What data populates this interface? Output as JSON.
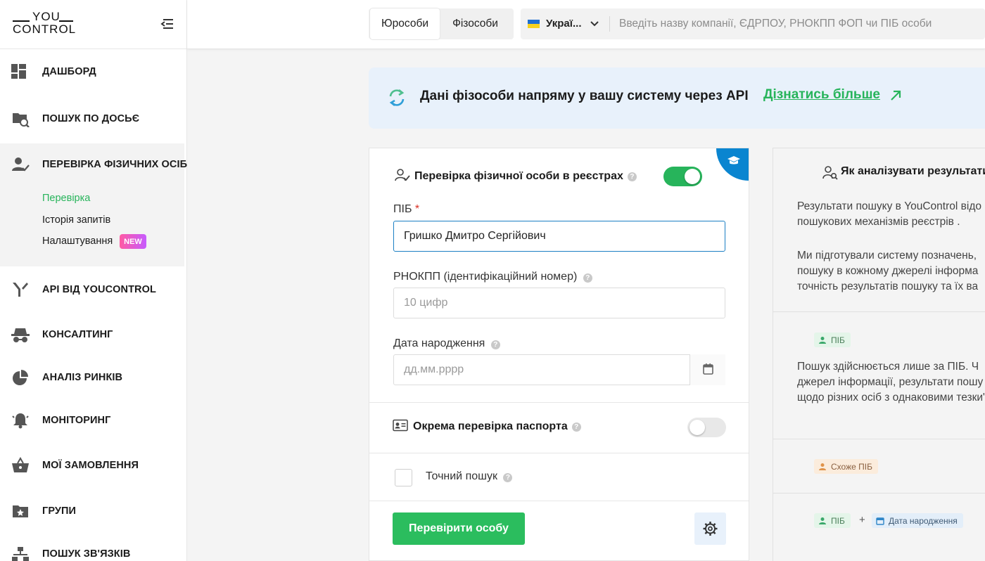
{
  "logo": {
    "line1": "YOU",
    "line2": "CONTROL"
  },
  "sidebar": {
    "items": [
      {
        "label": "ДАШБОРД",
        "icon": "dashboard-icon"
      },
      {
        "label": "ПОШУК ПО ДОСЬЄ",
        "icon": "folder-search-icon"
      },
      {
        "label": "ПЕРЕВІРКА ФІЗИЧНИХ ОСІБ",
        "icon": "person-check-icon"
      },
      {
        "label": "API ВІД YOUCONTROL",
        "icon": "api-icon"
      },
      {
        "label": "КОНСАЛТИНГ",
        "icon": "spy-icon"
      },
      {
        "label": "АНАЛІЗ РИНКІВ",
        "icon": "pie-chart-icon"
      },
      {
        "label": "МОНІТОРИНГ",
        "icon": "bell-icon"
      },
      {
        "label": "МОЇ ЗАМОВЛЕННЯ",
        "icon": "basket-icon"
      },
      {
        "label": "ГРУПИ",
        "icon": "folder-star-icon"
      },
      {
        "label": "ПОШУК ЗВ'ЯЗКІВ",
        "icon": "hierarchy-icon"
      }
    ],
    "subitems": [
      {
        "label": "Перевірка",
        "current": true
      },
      {
        "label": "Історія запитів",
        "current": false
      },
      {
        "label": "Налаштування",
        "current": false
      }
    ],
    "new_badge": "NEW"
  },
  "topbar": {
    "tabs": [
      {
        "label": "Юрособи",
        "active": true
      },
      {
        "label": "Фізособи",
        "active": false
      }
    ],
    "country": "Украї...",
    "search_placeholder": "Введіть назву компанії, ЄДРПОУ, РНОКПП ФОП чи ПІБ особи"
  },
  "banner": {
    "text": "Дані фізособи напряму у вашу систему через API",
    "link": "Дізнатись більше"
  },
  "form": {
    "title": "Перевірка фізичної особи в реєстрах",
    "main_toggle_on": true,
    "name_label": "ПІБ",
    "name_required": "*",
    "name_value": "Гришко Дмитро Сергійович",
    "tax_label": "РНОКПП (ідентифікаційний номер)",
    "tax_placeholder": "10 цифр",
    "birth_label": "Дата народження",
    "birth_placeholder": "дд.мм.рррр",
    "passport_label": "Окрема перевірка паспорта",
    "passport_toggle_on": false,
    "exact_label": "Точний пошук",
    "exact_checked": false,
    "submit": "Перевірити особу",
    "help": "?"
  },
  "info": {
    "title": "Як аналізувати результати п",
    "p1": "Результати пошуку в YouControl відо пошукових механізмів реєстрів .",
    "p2": "Ми підготували систему позначень, пошуку в кожному джерелі інформа точність результатів пошуку та їх ва",
    "tag_name": "ПІБ",
    "p3": "Пошук здійснюється лише за ПІБ. Ч джерел інформації, результати пошу дані щодо різних осіб з однаковими тезки\").",
    "tag_similar": "Схоже ПІБ",
    "tag_name2": "ПІБ",
    "plus": "+",
    "tag_birth": "Дата народження"
  },
  "colors": {
    "accent_green": "#2bbd5e",
    "link_green": "#27b45b",
    "focus_blue": "#1b7fc4",
    "banner_bg": "#e8f1fb",
    "corner_blue": "#0a85d0"
  }
}
